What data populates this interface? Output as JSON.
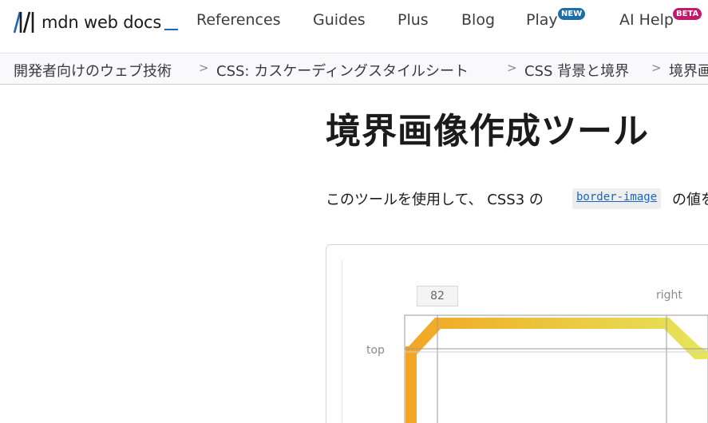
{
  "header": {
    "logo_text": "mdn web docs",
    "nav": [
      {
        "label": "References"
      },
      {
        "label": "Guides"
      },
      {
        "label": "Plus"
      },
      {
        "label": "Blog"
      },
      {
        "label": "Play",
        "badge": "NEW"
      },
      {
        "label": "AI Help",
        "badge": "BETA"
      }
    ]
  },
  "breadcrumb": [
    "開発者向けのウェブ技術",
    "CSS: カスケーディングスタイルシート",
    "CSS 背景と境界",
    "境界画"
  ],
  "main": {
    "title": "境界画像作成ツール",
    "intro_text": "このツールを使用して、 CSS3 の",
    "intro_code": "border-image",
    "intro_tail": "の値を"
  },
  "tool": {
    "value_box": "82",
    "label_right": "right",
    "label_top": "top"
  },
  "colors": {
    "accent": "#1b64c6",
    "badge_new": "#1b6ea8",
    "badge_beta": "#c4186b",
    "border_gradient_start": "#f2a623",
    "border_gradient_end": "#e6e65a"
  }
}
